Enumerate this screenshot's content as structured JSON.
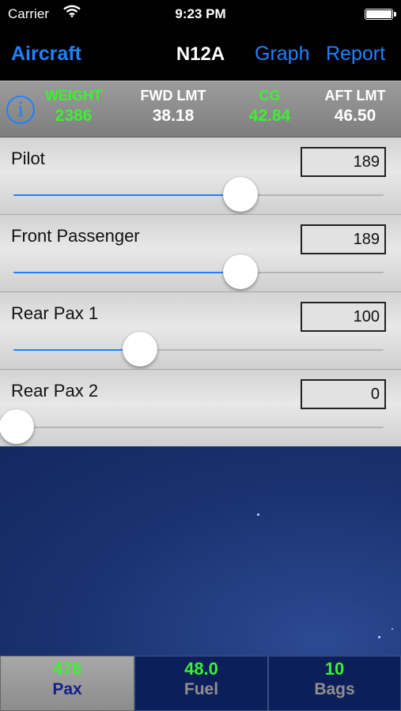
{
  "status_bar": {
    "carrier": "Carrier",
    "time": "9:23 PM"
  },
  "nav": {
    "left_button": "Aircraft",
    "title": "N12A",
    "graph_button": "Graph",
    "report_button": "Report"
  },
  "summary": {
    "weight": {
      "label": "WEIGHT",
      "value": "2386",
      "color": "#3af22e"
    },
    "fwd_lmt": {
      "label": "FWD LMT",
      "value": "38.18",
      "color": "#ffffff"
    },
    "cg": {
      "label": "CG",
      "value": "42.84",
      "color": "#3af22e"
    },
    "aft_lmt": {
      "label": "AFT LMT",
      "value": "46.50",
      "color": "#ffffff"
    }
  },
  "rows": [
    {
      "label": "Pilot",
      "value": "189",
      "slider_fraction": 0.615
    },
    {
      "label": "Front Passenger",
      "value": "189",
      "slider_fraction": 0.615
    },
    {
      "label": "Rear Pax 1",
      "value": "100",
      "slider_fraction": 0.34
    },
    {
      "label": "Rear Pax 2",
      "value": "0",
      "slider_fraction": 0.0
    }
  ],
  "tabs": [
    {
      "value": "478",
      "label": "Pax",
      "active": true
    },
    {
      "value": "48.0",
      "label": "Fuel",
      "active": false
    },
    {
      "value": "10",
      "label": "Bags",
      "active": false
    }
  ],
  "colors": {
    "accent": "#1e82ff",
    "ok_green": "#3af22e"
  }
}
